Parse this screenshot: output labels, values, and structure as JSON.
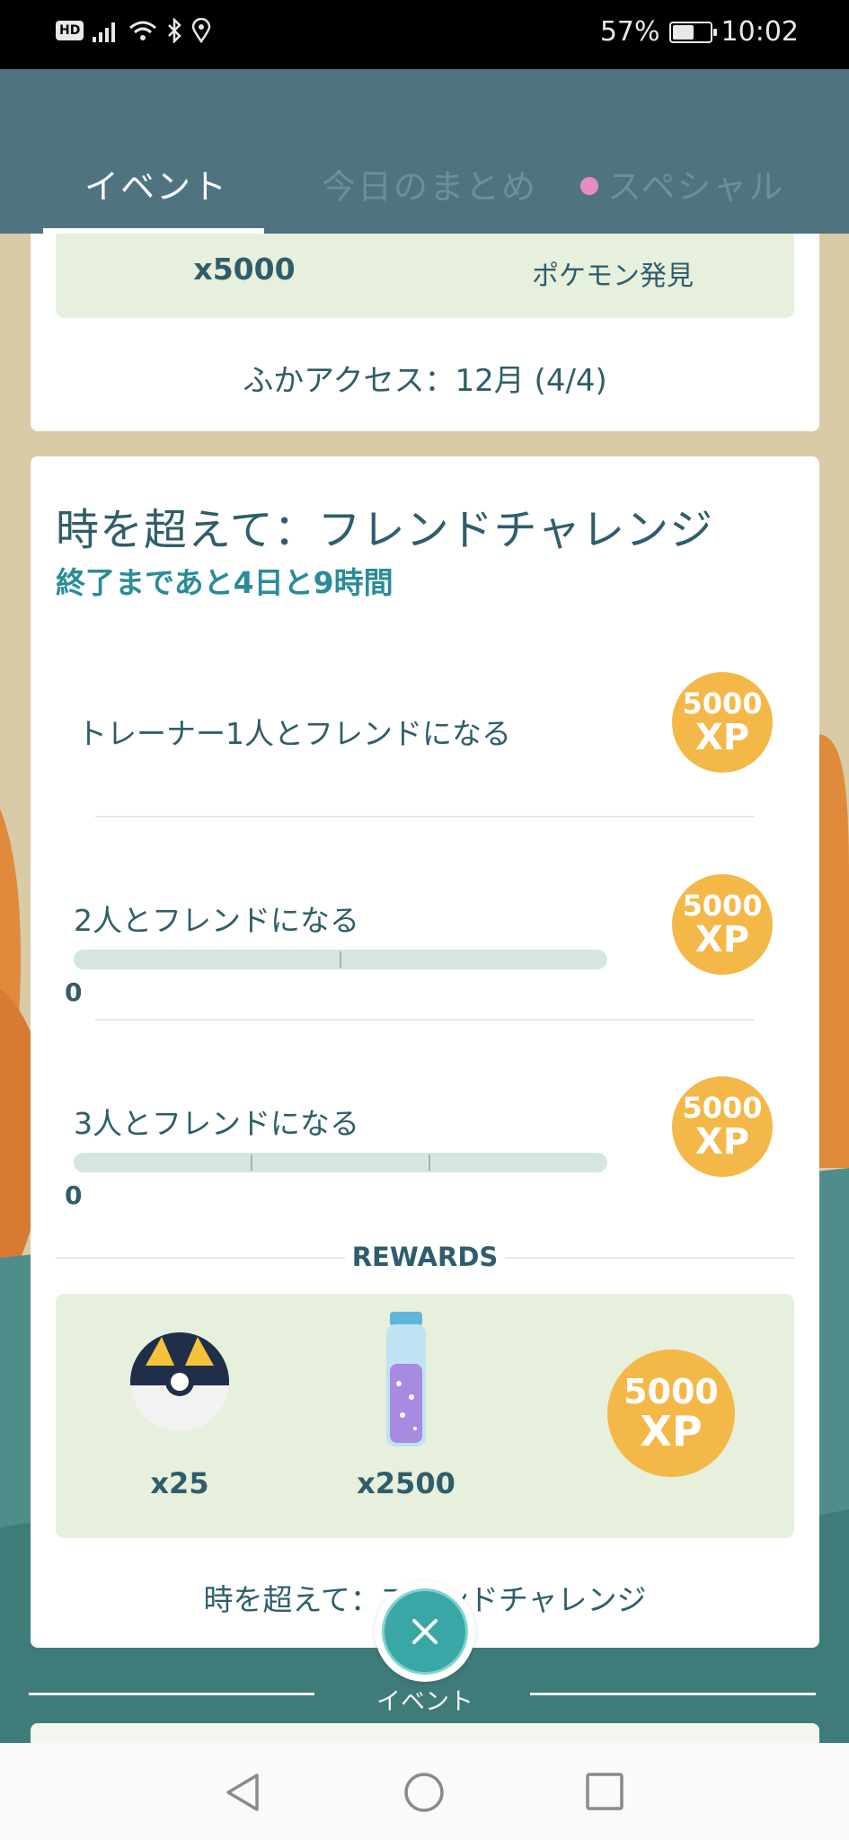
{
  "status_bar": {
    "badge": "HD",
    "battery_percent": "57%",
    "battery_level": 0.57,
    "time": "10:02"
  },
  "tabs": [
    {
      "label": "イベント",
      "active": true
    },
    {
      "label": "今日のまとめ",
      "active": false
    },
    {
      "label": "スペシャル",
      "active": false,
      "has_dot": true
    }
  ],
  "top_card": {
    "amount": "x5000",
    "label": "ポケモン発見",
    "access_text": "ふかアクセス：12月 (4/4)"
  },
  "challenge": {
    "title": "時を超えて：フレンドチャレンジ",
    "time_left": "終了まであと4日と9時間",
    "tasks": [
      {
        "label": "トレーナー1人とフレンドになる",
        "xp_number": "5000",
        "xp_unit": "XP"
      },
      {
        "label": "2人とフレンドになる",
        "xp_number": "5000",
        "xp_unit": "XP",
        "progress": "0",
        "progress_fraction": 0
      },
      {
        "label": "3人とフレンドになる",
        "xp_number": "5000",
        "xp_unit": "XP",
        "progress": "0",
        "progress_fraction": 0
      }
    ],
    "rewards_heading": "REWARDS",
    "rewards": [
      {
        "icon": "ultra-ball-icon",
        "amount": "x25"
      },
      {
        "icon": "stardust-icon",
        "amount": "x2500"
      },
      {
        "xp_number": "5000",
        "xp_unit": "XP"
      }
    ],
    "footer": "時を超えて：フレンドチャレンジ"
  },
  "close_fab": {
    "icon": "close-icon",
    "label": "イベント"
  },
  "nav": {
    "back": "back-icon",
    "home": "home-icon",
    "recents": "recents-icon"
  },
  "colors": {
    "header": "#507381",
    "accent_text": "#2a8c98",
    "xp_badge": "#f4b848",
    "reward_bg": "#e6f0dc",
    "fab": "#3aa7a6"
  }
}
